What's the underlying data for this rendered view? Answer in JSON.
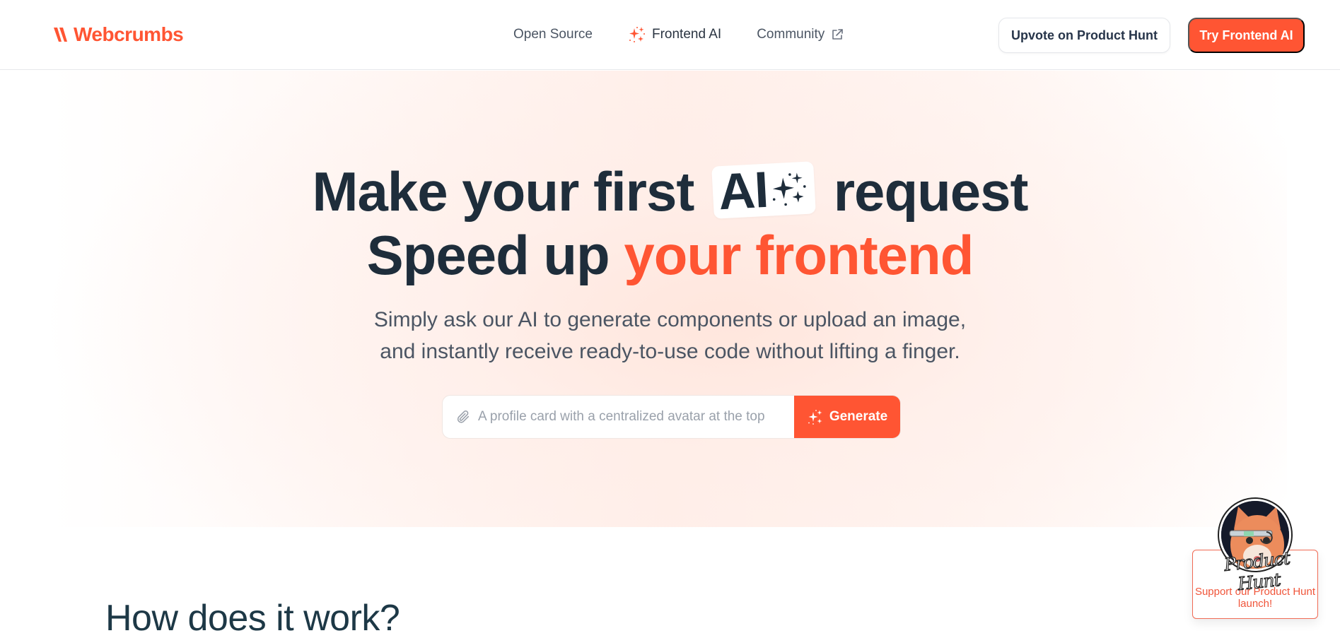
{
  "header": {
    "logo_text": "Webcrumbs",
    "nav": [
      {
        "label": "Open Source",
        "icon": null
      },
      {
        "label": "Frontend AI",
        "icon": "sparkles-icon"
      },
      {
        "label": "Community",
        "icon": "external-link-icon"
      }
    ],
    "upvote_label": "Upvote on Product Hunt",
    "try_label": "Try Frontend AI"
  },
  "hero": {
    "line1_before": "Make your first",
    "chip_text": "AI",
    "line1_after": "request",
    "line2_plain": "Speed up",
    "line2_accent": "your frontend",
    "subtitle_line1": "Simply ask our AI to generate components or upload an image,",
    "subtitle_line2": "and instantly receive ready-to-use code without lifting a finger.",
    "prompt": {
      "value": "",
      "placeholder": "A profile card with a centralized avatar at the top",
      "attach_icon": "paperclip-icon",
      "button_label": "Generate"
    }
  },
  "section": {
    "title": "How does it work?"
  },
  "product_hunt_widget": {
    "script_text": "Product Hunt",
    "message": "Support our Product Hunt launch!"
  },
  "colors": {
    "brand": "#ff5533",
    "text_dark": "#1e2d3b",
    "text_muted": "#4b5563"
  }
}
